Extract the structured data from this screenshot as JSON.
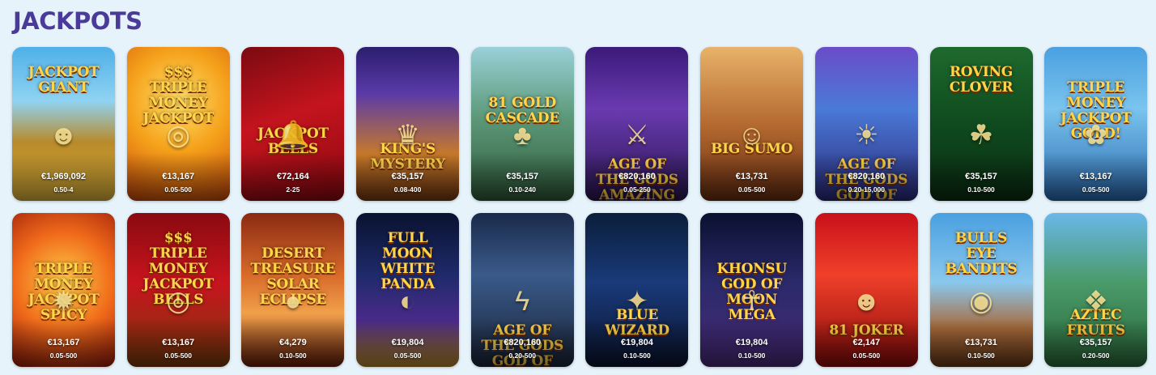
{
  "section": {
    "title": "JACKPOTS"
  },
  "games": [
    {
      "id": "jackpot-giant",
      "art": "Jackpot Giant",
      "amount": "€1,969,092",
      "range": "0.50-4",
      "bg": "linear-gradient(180deg,#4fb0e8 0%,#8fd3f2 35%,#b88a2a 62%,#e0b43a 100%)",
      "icon": "☻"
    },
    {
      "id": "triple-money-jackpot",
      "art": "$$$\nTriple Money\nJackpot",
      "amount": "€13,167",
      "range": "0.05-500",
      "bg": "radial-gradient(circle at 50% 35%,#ffe36a 0%,#f5a01a 45%,#c8480a 100%)",
      "icon": "◎"
    },
    {
      "id": "jackpot-bells",
      "art": "\n\n\n\nJackpot Bells",
      "amount": "€72,164",
      "range": "2-25",
      "bg": "linear-gradient(160deg,#7a0a10 0%,#c4141e 45%,#8c0810 100%)",
      "icon": "🔔"
    },
    {
      "id": "kings-mystery",
      "art": "\n\n\n\n\nKing's Mystery",
      "amount": "€35,157",
      "range": "0.08-400",
      "bg": "linear-gradient(180deg,#2a1e6e 0%,#5a3aa8 30%,#c77a2a 70%,#7a3a12 100%)",
      "icon": "♛"
    },
    {
      "id": "81-gold-cascade",
      "art": "\n\n81 Gold\nCascade",
      "amount": "€35,157",
      "range": "0.10-240",
      "bg": "linear-gradient(180deg,#9ad0d8 0%,#5d9a7a 45%,#2f5a3a 100%)",
      "icon": "♣"
    },
    {
      "id": "age-of-gods-amazing-wild",
      "art": "\n\n\n\n\n\nAge of the Gods\nAmazing Wild",
      "amount": "€820,160",
      "range": "0.05-250",
      "bg": "linear-gradient(180deg,#3a1a7a 0%,#6a3ab0 40%,#2a1650 100%)",
      "icon": "⚔"
    },
    {
      "id": "big-sumo",
      "art": "\n\n\n\n\nBig Sumo",
      "amount": "€13,731",
      "range": "0.05-500",
      "bg": "linear-gradient(180deg,#e8b26a 0%,#b56a30 50%,#6a2e12 100%)",
      "icon": "☺"
    },
    {
      "id": "age-of-gods-god-of-gold",
      "art": "\n\n\n\n\n\nAge of the Gods\nGod of Gold",
      "amount": "€820,160",
      "range": "0.20-15,000",
      "bg": "linear-gradient(180deg,#6a4cc8 0%,#4a7ad8 40%,#2a2a7a 100%)",
      "icon": "☀"
    },
    {
      "id": "roving-clover",
      "art": "Roving\nClover",
      "amount": "€35,157",
      "range": "0.10-500",
      "bg": "linear-gradient(180deg,#1e6a2e 0%,#0f4a1e 50%,#0a2e12 100%)",
      "icon": "☘"
    },
    {
      "id": "triple-money-jackpot-gold",
      "art": "\nTriple Money\nJackpot\nGold!",
      "amount": "€13,167",
      "range": "0.05-500",
      "bg": "linear-gradient(180deg,#4aa0e0 0%,#7ac4ee 40%,#2a6ab0 100%)",
      "icon": "✿"
    },
    {
      "id": "triple-money-jackpot-spicy",
      "art": "\n\nTriple Money\nJackpot\nSpicy",
      "amount": "€13,167",
      "range": "0.05-500",
      "bg": "radial-gradient(circle at 50% 45%,#ffcf4a 0%,#f06a1a 50%,#9a1a0a 100%)",
      "icon": "✹"
    },
    {
      "id": "triple-money-jackpot-bells",
      "art": "$$$\nTriple Money\nJackpot Bells",
      "amount": "€13,167",
      "range": "0.05-500",
      "bg": "linear-gradient(180deg,#8a0a10 0%,#c8141e 45%,#7a3a0a 100%)",
      "icon": "◎"
    },
    {
      "id": "desert-treasure-solar-eclipse",
      "art": "\nDesert Treasure\nSolar\nEclipse",
      "amount": "€4,279",
      "range": "0.10-500",
      "bg": "linear-gradient(180deg,#8a2a12 0%,#d86a2a 40%,#f0a04a 65%,#6a1e0a 100%)",
      "icon": "●"
    },
    {
      "id": "full-moon-white-panda",
      "art": "Full Moon\nWhite\nPanda",
      "amount": "€19,804",
      "range": "0.05-500",
      "bg": "linear-gradient(180deg,#0a1230 0%,#1e2a6a 40%,#4a2a8a 70%,#b88a2a 100%)",
      "icon": "◐"
    },
    {
      "id": "age-of-gods-god-of-storms",
      "art": "\n\n\n\n\n\nAge of the Gods\nGod of Storms",
      "amount": "€820,160",
      "range": "0.20-500",
      "bg": "linear-gradient(180deg,#1a2a4a 0%,#3a5a8a 40%,#1a2438 100%)",
      "icon": "ϟ"
    },
    {
      "id": "blue-wizard",
      "art": "\n\n\n\n\nBlue Wizard",
      "amount": "€19,804",
      "range": "0.10-500",
      "bg": "linear-gradient(180deg,#0a1e3a 0%,#1a3a7a 45%,#0a1430 100%)",
      "icon": "✦"
    },
    {
      "id": "khonsu-god-of-moon",
      "art": "\n\nKhonsu\nGod of Moon\nMega",
      "amount": "€19,804",
      "range": "0.10-500",
      "bg": "linear-gradient(180deg,#0a1030 0%,#2a2a6a 45%,#4a2a7a 100%)",
      "icon": "☥"
    },
    {
      "id": "joker-hot-reels",
      "art": "\n\n\n\n\n\n81 Joker",
      "amount": "€2,147",
      "range": "0.05-500",
      "bg": "linear-gradient(180deg,#c8101a 0%,#f0402a 40%,#8a0a0a 100%)",
      "icon": "☻"
    },
    {
      "id": "bulls-eye-bandits",
      "art": "Bulls\nEye\nBandits",
      "amount": "€13,731",
      "range": "0.10-500",
      "bg": "linear-gradient(180deg,#4aa0e0 0%,#8ac8ee 45%,#a86a3a 75%,#6a3a1a 100%)",
      "icon": "◉"
    },
    {
      "id": "aztec-fruits",
      "art": "\n\n\n\n\nAztec\nFruits",
      "amount": "€35,157",
      "range": "0.20-500",
      "bg": "linear-gradient(180deg,#6ab8e8 0%,#4a9a6a 45%,#2a6a3a 100%)",
      "icon": "❖"
    }
  ]
}
